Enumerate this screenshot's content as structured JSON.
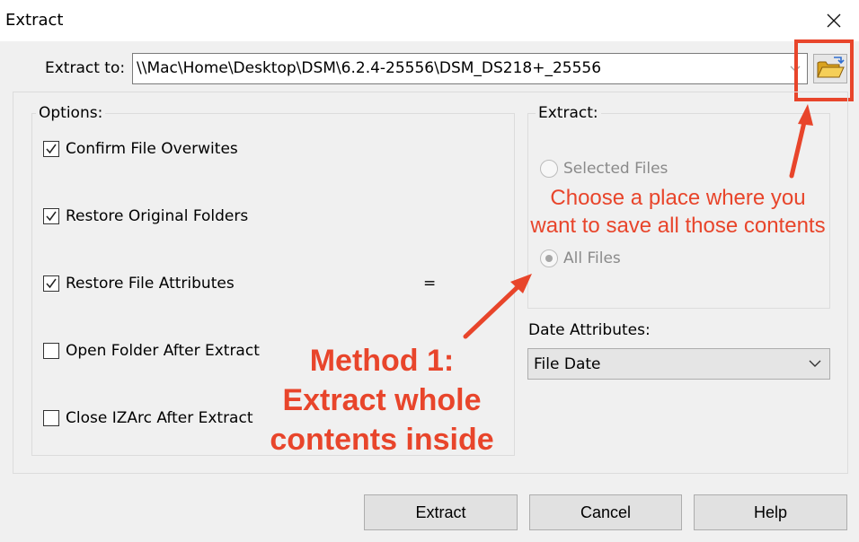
{
  "window": {
    "title": "Extract"
  },
  "extract_to": {
    "label": "Extract to:",
    "path": "\\\\Mac\\Home\\Desktop\\DSM\\6.2.4-25556\\DSM_DS218+_25556"
  },
  "options": {
    "title": "Options:",
    "items": [
      {
        "label": "Confirm File Overwites",
        "checked": true
      },
      {
        "label": "Restore Original Folders",
        "checked": true
      },
      {
        "label": "Restore File Attributes",
        "checked": true
      },
      {
        "label": "Open Folder After Extract",
        "checked": false
      },
      {
        "label": "Close IZArc After Extract",
        "checked": false
      }
    ],
    "separator_glyph": "="
  },
  "extract_group": {
    "title": "Extract:",
    "selected_files": "Selected Files",
    "all_files": "All Files",
    "selected": "All Files"
  },
  "date_attributes": {
    "label": "Date Attributes:",
    "value": "File Date"
  },
  "buttons": {
    "extract": "Extract",
    "cancel": "Cancel",
    "help": "Help"
  },
  "annotations": {
    "choose_place_line1": "Choose a place where you",
    "choose_place_line2": "want to save all those contents",
    "method_line1": "Method 1:",
    "method_line2": "Extract whole",
    "method_line3": "contents inside",
    "color": "#e8452b"
  },
  "icons": {
    "close": "close-icon",
    "dropdown": "chevron-down-icon",
    "browse": "folder-icon",
    "check": "checkmark-icon"
  }
}
